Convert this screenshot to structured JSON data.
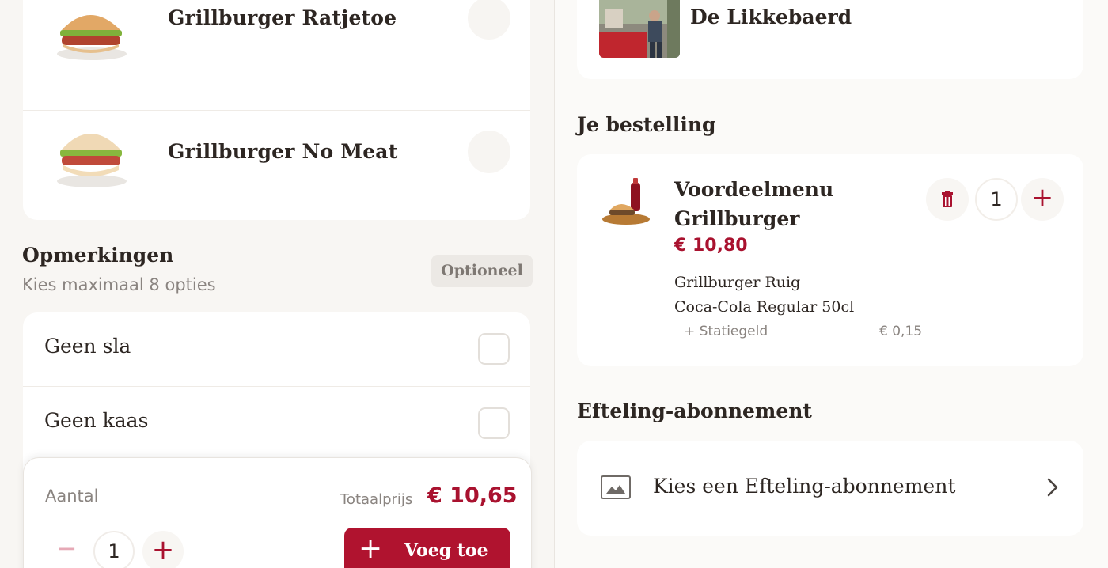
{
  "left": {
    "products": [
      {
        "name": "Grillburger Ratjetoe"
      },
      {
        "name": "Grillburger No Meat"
      }
    ],
    "remarks": {
      "title": "Opmerkingen",
      "subtitle": "Kies maximaal 8 opties",
      "badge": "Optioneel",
      "options": [
        {
          "label": "Geen sla"
        },
        {
          "label": "Geen kaas"
        }
      ]
    },
    "bottom_bar": {
      "quantity_label": "Aantal",
      "quantity": "1",
      "minus": "−",
      "plus": "+",
      "total_label": "Totaalprijs",
      "total_value": "€ 10,65",
      "add_label": "Voeg toe",
      "add_plus": "+"
    }
  },
  "right": {
    "restaurant": {
      "name": "De Likkebaerd"
    },
    "order": {
      "title": "Je bestelling",
      "item_name": "Voordeelmenu Grillburger",
      "item_price": "€ 10,80",
      "components": [
        "Grillburger Ruig",
        "Coca-Cola Regular 50cl"
      ],
      "deposit_label": "+ Statiegeld",
      "deposit_value": "€ 0,15",
      "quantity": "1",
      "plus": "+"
    },
    "subscription": {
      "title": "Efteling-abonnement",
      "choose_label": "Kies een Efteling-abonnement"
    }
  },
  "colors": {
    "accent": "#b0132f",
    "price": "#a9122f",
    "muted_text": "#8a8480",
    "background": "#f8f6f3",
    "card": "#ffffff"
  },
  "icons": {
    "trash": "trash-icon",
    "chevron": "chevron-right-icon",
    "image_placeholder": "image-placeholder-icon"
  }
}
